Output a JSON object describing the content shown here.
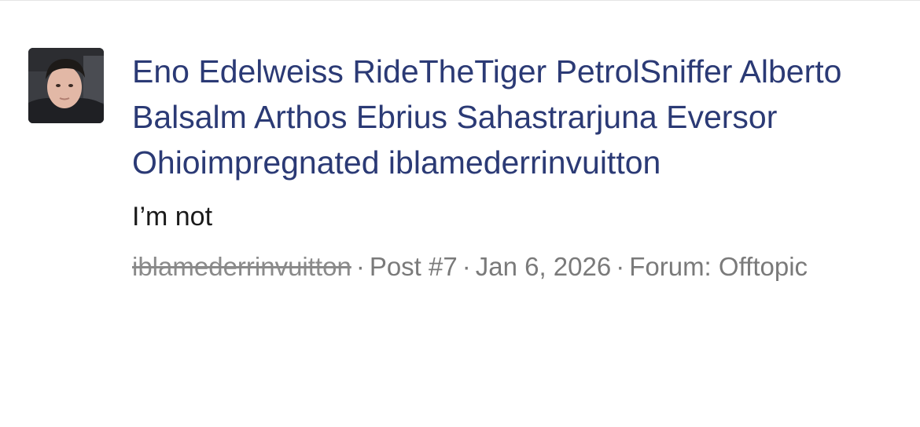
{
  "post": {
    "title": "Eno Edelweiss RideTheTiger PetrolSniffer Alberto Balsalm Arthos Ebrius Sahastrarjuna Eversor Ohioimpregnated iblamederrinvuitton",
    "body": "I’m not",
    "meta": {
      "author": "iblamederrinvuitton",
      "separator": "·",
      "post_number": "Post #7",
      "date": "Jan 6, 2026",
      "forum_label": "Forum:",
      "forum_name": "Offtopic"
    }
  },
  "colors": {
    "title": "#2b3a75",
    "body": "#1a1a1a",
    "meta": "#7a7a7a"
  }
}
